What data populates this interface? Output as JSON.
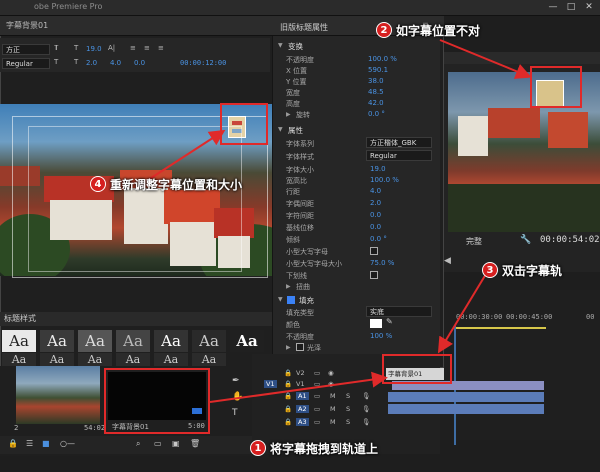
{
  "app": {
    "title": "obe Premiere Pro",
    "window_buttons": [
      "—",
      "□",
      "✕"
    ]
  },
  "editor": {
    "title": "字幕背景01",
    "toolbar": {
      "font": "方正",
      "style": "Regular",
      "size": "19.0",
      "leading": "2.0",
      "kerning": "4.0",
      "tab": "0.0",
      "timecode": "00:00:12:00"
    }
  },
  "props": {
    "header": "旧版标题属性",
    "sections": {
      "transform": "变换",
      "properties": "属性",
      "fill": "填充"
    },
    "transform": [
      {
        "label": "不透明度",
        "value": "100.0 %"
      },
      {
        "label": "X 位置",
        "value": "590.1"
      },
      {
        "label": "Y 位置",
        "value": "38.0"
      },
      {
        "label": "宽度",
        "value": "48.5"
      },
      {
        "label": "高度",
        "value": "42.0"
      },
      {
        "label": "旋转",
        "value": "0.0 °"
      }
    ],
    "properties": [
      {
        "label": "字体系列",
        "value": "方正楷体_GBK",
        "dropdown": true
      },
      {
        "label": "字体样式",
        "value": "Regular",
        "dropdown": true
      },
      {
        "label": "字体大小",
        "value": "19.0"
      },
      {
        "label": "宽高比",
        "value": "100.0 %"
      },
      {
        "label": "行距",
        "value": "4.0"
      },
      {
        "label": "字偶间距",
        "value": "2.0"
      },
      {
        "label": "字符间距",
        "value": "0.0"
      },
      {
        "label": "基线位移",
        "value": "0.0"
      },
      {
        "label": "倾斜",
        "value": "0.0 °"
      },
      {
        "label": "小型大写字母",
        "check": true
      },
      {
        "label": "小型大写字母大小",
        "value": "75.0 %"
      },
      {
        "label": "下划线",
        "check": true
      },
      {
        "label": "扭曲",
        "value": ""
      }
    ],
    "fill": [
      {
        "label": "填充类型",
        "value": "实底",
        "dropdown": true
      },
      {
        "label": "颜色",
        "value": ""
      },
      {
        "label": "不透明度",
        "value": "100 %"
      },
      {
        "label": "光泽",
        "check": true
      },
      {
        "label": "纹理",
        "check": true
      }
    ]
  },
  "styles_panel": {
    "title": "标题样式",
    "sample": "Aa"
  },
  "monitor": {
    "zoom": "完整",
    "timecode": "00:00:54:02"
  },
  "timeline": {
    "ruler_labels": [
      "00:00:30:00",
      "00:00:45:00",
      "00"
    ],
    "clip_label": "字幕背景01",
    "tracks": [
      "V2",
      "V1",
      "A1",
      "A2",
      "A3"
    ]
  },
  "bin": {
    "items": [
      {
        "label": "2",
        "duration": "54:02"
      },
      {
        "label": "字幕背景01",
        "duration": "5:00"
      }
    ]
  },
  "callouts": [
    {
      "num": "1",
      "text": "将字幕拖拽到轨道上"
    },
    {
      "num": "2",
      "text": "如字幕位置不对"
    },
    {
      "num": "3",
      "text": "双击字幕轨"
    },
    {
      "num": "4",
      "text": "重新调整字幕位置和大小"
    }
  ],
  "colors": {
    "callout": "#e02a2a",
    "accent": "#3d8fe0"
  }
}
